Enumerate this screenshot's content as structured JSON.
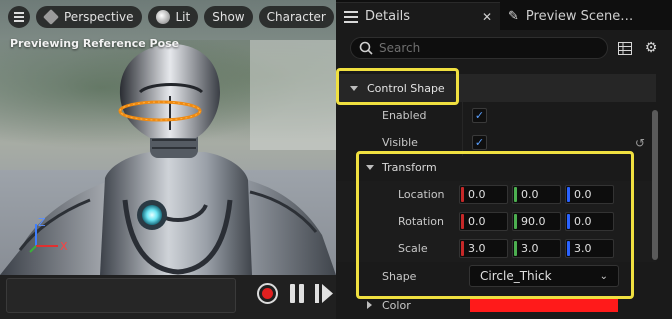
{
  "viewport": {
    "toolbar": {
      "menu_icon": "hamburger-icon",
      "perspective_label": "Perspective",
      "lit_label": "Lit",
      "show_label": "Show",
      "character_label": "Character"
    },
    "overlay_label": "Previewing Reference Pose",
    "axis": {
      "z": "Z",
      "x": "X"
    },
    "playback": {
      "record": "record-icon",
      "pause": "pause-icon",
      "play": "play-icon"
    }
  },
  "panel": {
    "tabs": [
      {
        "label": "Details",
        "icon": "details-icon",
        "close": "✕"
      },
      {
        "label": "Preview Scene…",
        "icon": "preview-scene-icon"
      }
    ],
    "search": {
      "placeholder": "Search",
      "value": ""
    },
    "tools": {
      "table_icon": "table-view-icon",
      "settings_icon": "gear-icon"
    },
    "control_shape": {
      "header": "Control Shape",
      "enabled_label": "Enabled",
      "enabled": true,
      "visible_label": "Visible",
      "visible": true,
      "transform": {
        "header": "Transform",
        "location_label": "Location",
        "location": [
          "0.0",
          "0.0",
          "0.0"
        ],
        "rotation_label": "Rotation",
        "rotation": [
          "0.0",
          "90.0",
          "0.0"
        ],
        "scale_label": "Scale",
        "scale": [
          "3.0",
          "3.0",
          "3.0"
        ]
      },
      "shape_label": "Shape",
      "shape_value": "Circle_Thick",
      "color_label": "Color",
      "color_value": "#ff1a1a"
    },
    "axis_colors": {
      "x": "#c62828",
      "y": "#4caf50",
      "z": "#2962ff"
    },
    "highlight_color": "#f0e040"
  }
}
